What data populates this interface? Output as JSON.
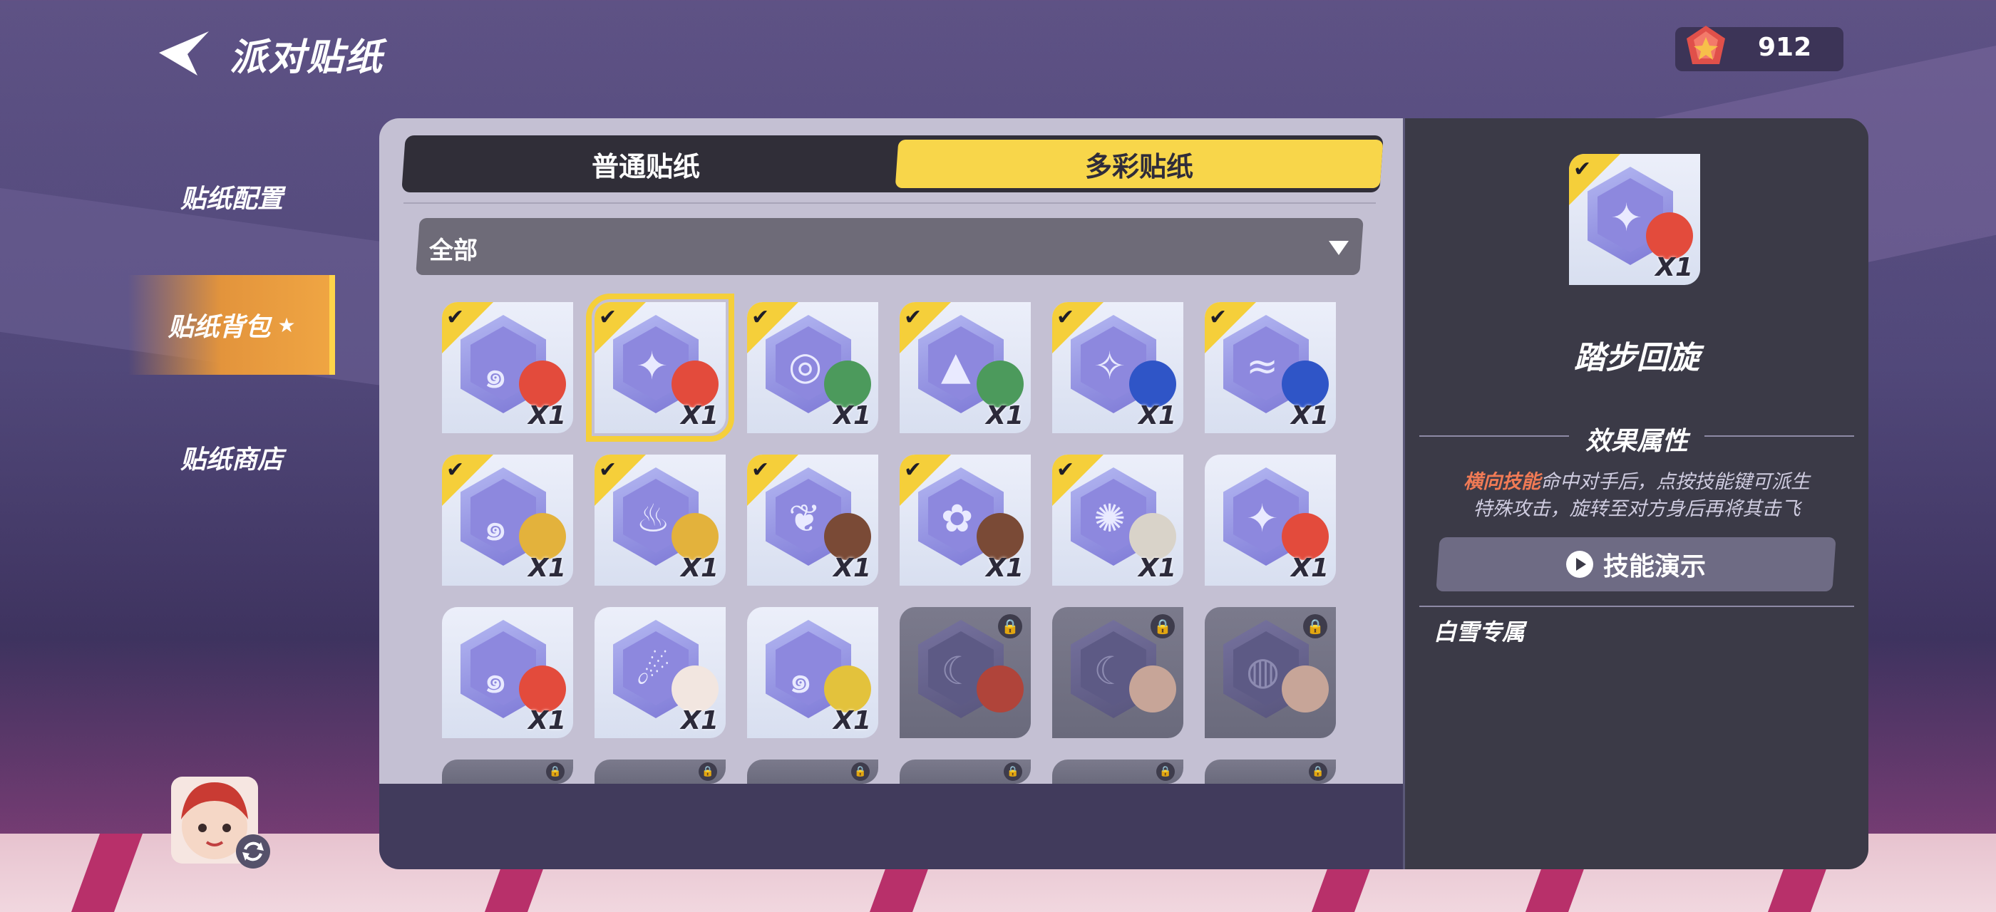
{
  "header": {
    "title": "派对贴纸",
    "currency_value": "912"
  },
  "nav": [
    {
      "label": "贴纸配置",
      "active": false
    },
    {
      "label": "贴纸背包",
      "active": true
    },
    {
      "label": "贴纸商店",
      "active": false
    }
  ],
  "tabs": {
    "normal": "普通贴纸",
    "colorful": "多彩贴纸",
    "selected": "colorful"
  },
  "filter": {
    "value": "全部"
  },
  "stickers": [
    {
      "qty": "X1",
      "owned": true,
      "selected": false,
      "locked": false,
      "face": "#e34b3c",
      "glyph": "swirl-icon"
    },
    {
      "qty": "X1",
      "owned": true,
      "selected": true,
      "locked": false,
      "face": "#e34b3c",
      "glyph": "star-icon"
    },
    {
      "qty": "X1",
      "owned": true,
      "selected": false,
      "locked": false,
      "face": "#4c9a5c",
      "glyph": "spiral-icon"
    },
    {
      "qty": "X1",
      "owned": true,
      "selected": false,
      "locked": false,
      "face": "#4c9a5c",
      "glyph": "mountain-icon"
    },
    {
      "qty": "X1",
      "owned": true,
      "selected": false,
      "locked": false,
      "face": "#2f55c7",
      "glyph": "sparkle-icon"
    },
    {
      "qty": "X1",
      "owned": true,
      "selected": false,
      "locked": false,
      "face": "#2f55c7",
      "glyph": "wind-icon"
    },
    {
      "qty": "X1",
      "owned": true,
      "selected": false,
      "locked": false,
      "face": "#e3b23c",
      "glyph": "swirl-icon"
    },
    {
      "qty": "X1",
      "owned": true,
      "selected": false,
      "locked": false,
      "face": "#e3b23c",
      "glyph": "flame-icon"
    },
    {
      "qty": "X1",
      "owned": true,
      "selected": false,
      "locked": false,
      "face": "#7a4a36",
      "glyph": "feather-icon"
    },
    {
      "qty": "X1",
      "owned": true,
      "selected": false,
      "locked": false,
      "face": "#7a4a36",
      "glyph": "gear-icon"
    },
    {
      "qty": "X1",
      "owned": true,
      "selected": false,
      "locked": false,
      "face": "#d9d3c9",
      "glyph": "burst-icon"
    },
    {
      "qty": "X1",
      "owned": false,
      "selected": false,
      "locked": false,
      "face": "#e34b3c",
      "glyph": "star-icon"
    },
    {
      "qty": "X1",
      "owned": false,
      "selected": false,
      "locked": false,
      "face": "#e34b3c",
      "glyph": "swirl-icon"
    },
    {
      "qty": "X1",
      "owned": false,
      "selected": false,
      "locked": false,
      "face": "#f2e6e0",
      "glyph": "comet-icon"
    },
    {
      "qty": "X1",
      "owned": false,
      "selected": false,
      "locked": false,
      "face": "#e3c23c",
      "glyph": "swirl-icon"
    },
    {
      "qty": "",
      "owned": false,
      "selected": false,
      "locked": true,
      "face": "#b0443a",
      "glyph": "moon-icon"
    },
    {
      "qty": "",
      "owned": false,
      "selected": false,
      "locked": true,
      "face": "#c7a598",
      "glyph": "moon-icon"
    },
    {
      "qty": "",
      "owned": false,
      "selected": false,
      "locked": true,
      "face": "#c7a598",
      "glyph": "orbit-icon"
    }
  ],
  "detail": {
    "qty": "X1",
    "name": "踏步回旋",
    "section_title": "效果属性",
    "desc_keyword": "横向技能",
    "desc_line1_rest": "命中对手后，点按技能键可派生",
    "desc_line2": "特殊攻击，旋转至对方身后再将其击飞",
    "demo_label": "技能演示",
    "exclusive": "白雪专属"
  },
  "colors": {
    "accent_yellow": "#f8d64a",
    "nav_active": "#e3943c",
    "keyword": "#f07a55"
  }
}
